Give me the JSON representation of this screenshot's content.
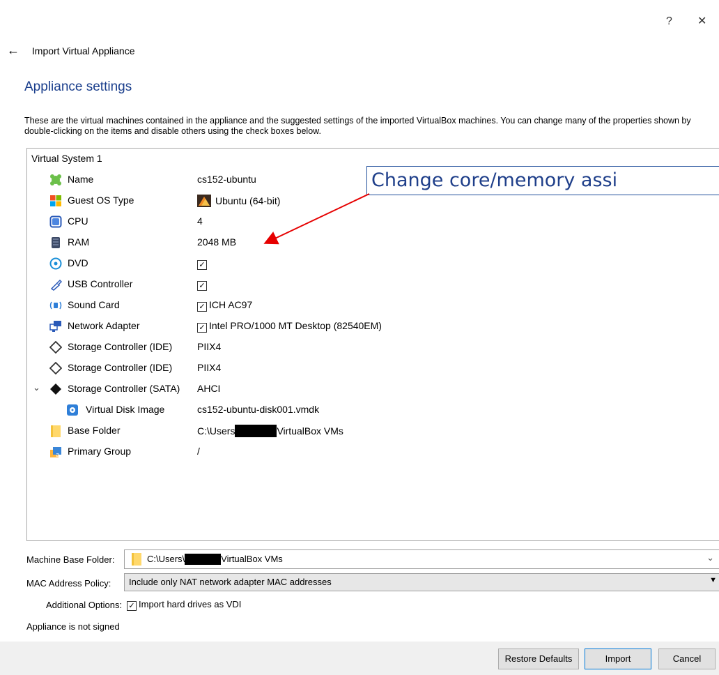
{
  "window": {
    "help_label": "?",
    "close_label": "✕",
    "back_icon": "←",
    "title": "Import Virtual Appliance"
  },
  "section_title": "Appliance settings",
  "description": "These are the virtual machines contained in the appliance and the suggested settings of the imported VirtualBox machines. You can change many of the properties shown by double-clicking on the items and disable others using the check boxes below.",
  "tree": {
    "root": "Virtual System 1",
    "rows": [
      {
        "label": "Name",
        "value": "cs152-ubuntu",
        "icon": "name-icon"
      },
      {
        "label": "Guest OS Type",
        "value": "Ubuntu (64-bit)",
        "icon": "os-type-icon"
      },
      {
        "label": "CPU",
        "value": "4",
        "icon": "cpu-icon"
      },
      {
        "label": "RAM",
        "value": "2048 MB",
        "icon": "ram-icon"
      },
      {
        "label": "DVD",
        "value": "",
        "checked": true,
        "icon": "dvd-icon"
      },
      {
        "label": "USB Controller",
        "value": "",
        "checked": true,
        "icon": "usb-icon"
      },
      {
        "label": "Sound Card",
        "value": "ICH AC97",
        "checked": true,
        "icon": "sound-card-icon"
      },
      {
        "label": "Network Adapter",
        "value": "Intel PRO/1000 MT Desktop (82540EM)",
        "checked": true,
        "icon": "network-adapter-icon"
      },
      {
        "label": "Storage Controller (IDE)",
        "value": "PIIX4",
        "icon": "storage-ide-icon"
      },
      {
        "label": "Storage Controller (IDE)",
        "value": "PIIX4",
        "icon": "storage-ide-icon"
      },
      {
        "label": "Storage Controller (SATA)",
        "value": "AHCI",
        "icon": "storage-sata-icon"
      },
      {
        "label": "Virtual Disk Image",
        "value": "cs152-ubuntu-disk001.vmdk",
        "icon": "disk-image-icon"
      },
      {
        "label": "Base Folder",
        "value_prefix": "C:\\Users",
        "value_suffix": "VirtualBox VMs",
        "icon": "folder-icon"
      },
      {
        "label": "Primary Group",
        "value": "/",
        "icon": "group-icon"
      }
    ]
  },
  "annotation": {
    "text": "Change core/memory assi"
  },
  "form": {
    "base_folder_label": "Machine Base Folder:",
    "base_folder_prefix": "C:\\Users\\",
    "base_folder_suffix": "VirtualBox VMs",
    "mac_policy_label": "MAC Address Policy:",
    "mac_policy_value": "Include only NAT network adapter MAC addresses",
    "additional_options_label": "Additional Options:",
    "import_vdi_label": "Import hard drives as VDI",
    "signed_status": "Appliance is not signed"
  },
  "buttons": {
    "restore_defaults": "Restore Defaults",
    "import": "Import",
    "cancel": "Cancel"
  },
  "colors": {
    "section_title": "#1a3e8c",
    "annotation_border": "#1f4e9b",
    "arrow": "#e60000"
  }
}
